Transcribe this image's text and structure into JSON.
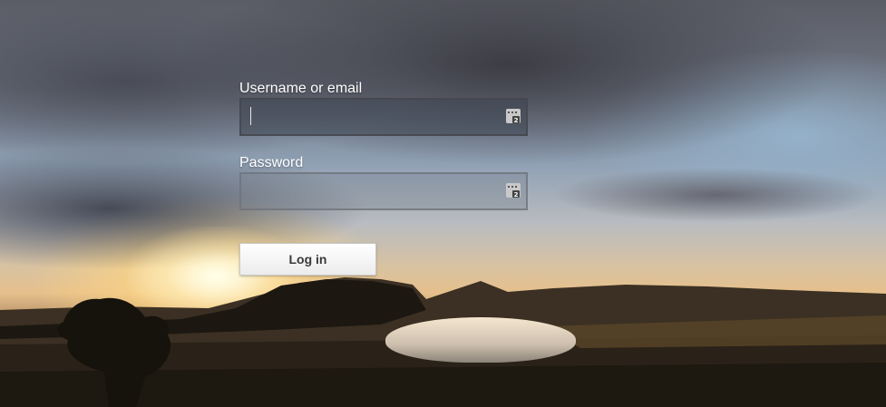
{
  "background": {
    "scene": "sunset-landscape-with-lake"
  },
  "login": {
    "username_label": "Username or email",
    "username_value": "",
    "password_label": "Password",
    "password_value": "",
    "field_icon": "password-manager-key-icon",
    "submit_label": "Log in"
  },
  "colors": {
    "label_text": "#ffffff",
    "button_bg": "#f5f5f5",
    "button_text": "#3a3a3a"
  }
}
